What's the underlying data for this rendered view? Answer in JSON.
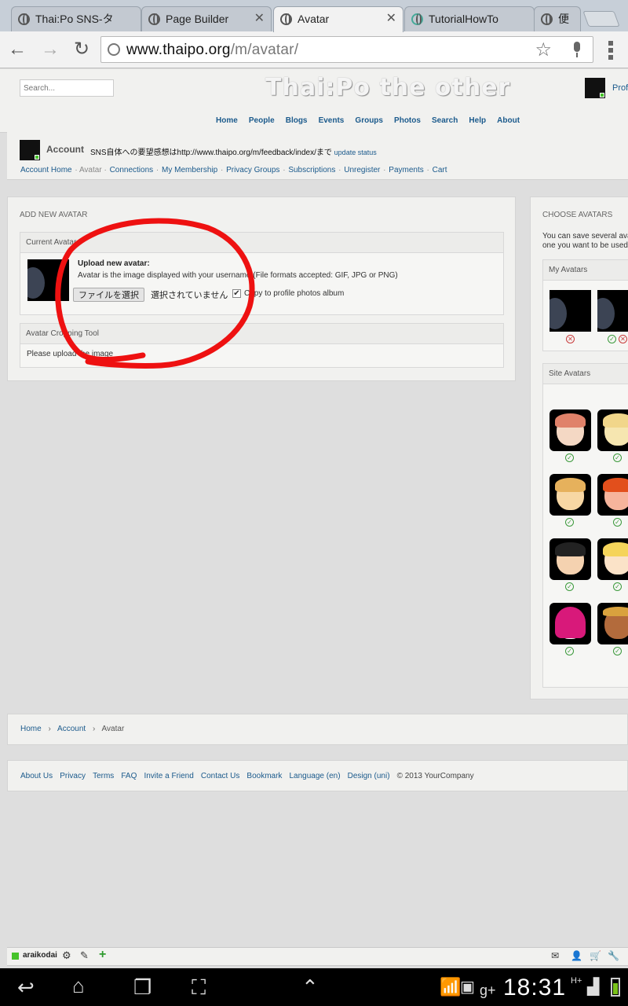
{
  "browser": {
    "tabs": [
      {
        "label": "Thai:Po SNS-タ"
      },
      {
        "label": "Page Builder"
      },
      {
        "label": "Avatar",
        "active": true
      },
      {
        "label": "TutorialHowTo"
      },
      {
        "label": "便"
      }
    ],
    "url_domain": "www.thaipo.org",
    "url_path": "/m/avatar/"
  },
  "site": {
    "search_placeholder": "Search...",
    "title": "Thai:Po the other",
    "profile_label": "Profi",
    "nav": [
      "Home",
      "People",
      "Blogs",
      "Events",
      "Groups",
      "Photos",
      "Search",
      "Help",
      "About"
    ]
  },
  "account": {
    "title": "Account",
    "status": "SNS自体への要望感想はhttp://www.thaipo.org/m/feedback/index/まで",
    "update_status": "update status",
    "links": [
      "Account Home",
      "Avatar",
      "Connections",
      "My Membership",
      "Privacy Groups",
      "Subscriptions",
      "Unregister",
      "Payments",
      "Cart"
    ]
  },
  "add_avatar": {
    "panel_title": "ADD NEW AVATAR",
    "current_avatar_head": "Current Avatar",
    "upload_title": "Upload new avatar:",
    "upload_desc": "Avatar is the image displayed with your username (File formats accepted: GIF, JPG or PNG)",
    "file_button": "ファイルを選択",
    "file_status": "選択されていません",
    "copy_label": "Copy to profile photos album",
    "copy_checked": true,
    "cropping_head": "Avatar Cropping Tool",
    "cropping_body": "Please upload the image"
  },
  "choose_avatars": {
    "panel_title": "CHOOSE AVATARS",
    "desc_line1": "You can save several ava",
    "desc_line2": "one you want to be used",
    "my_avatars_head": "My Avatars",
    "site_avatars_head": "Site Avatars"
  },
  "breadcrumb": [
    "Home",
    "Account",
    "Avatar"
  ],
  "footer": {
    "links": [
      "About Us",
      "Privacy",
      "Terms",
      "FAQ",
      "Invite a Friend",
      "Contact Us",
      "Bookmark",
      "Language (en)",
      "Design (uni)"
    ],
    "copyright": "© 2013 YourCompany"
  },
  "bottom_toolbar": {
    "username": "araikodai"
  },
  "system": {
    "clock": "18:31",
    "network": "H+"
  },
  "colors": {
    "link": "#1b5a8c",
    "annotation": "#ee1111",
    "online": "#46c32b"
  }
}
